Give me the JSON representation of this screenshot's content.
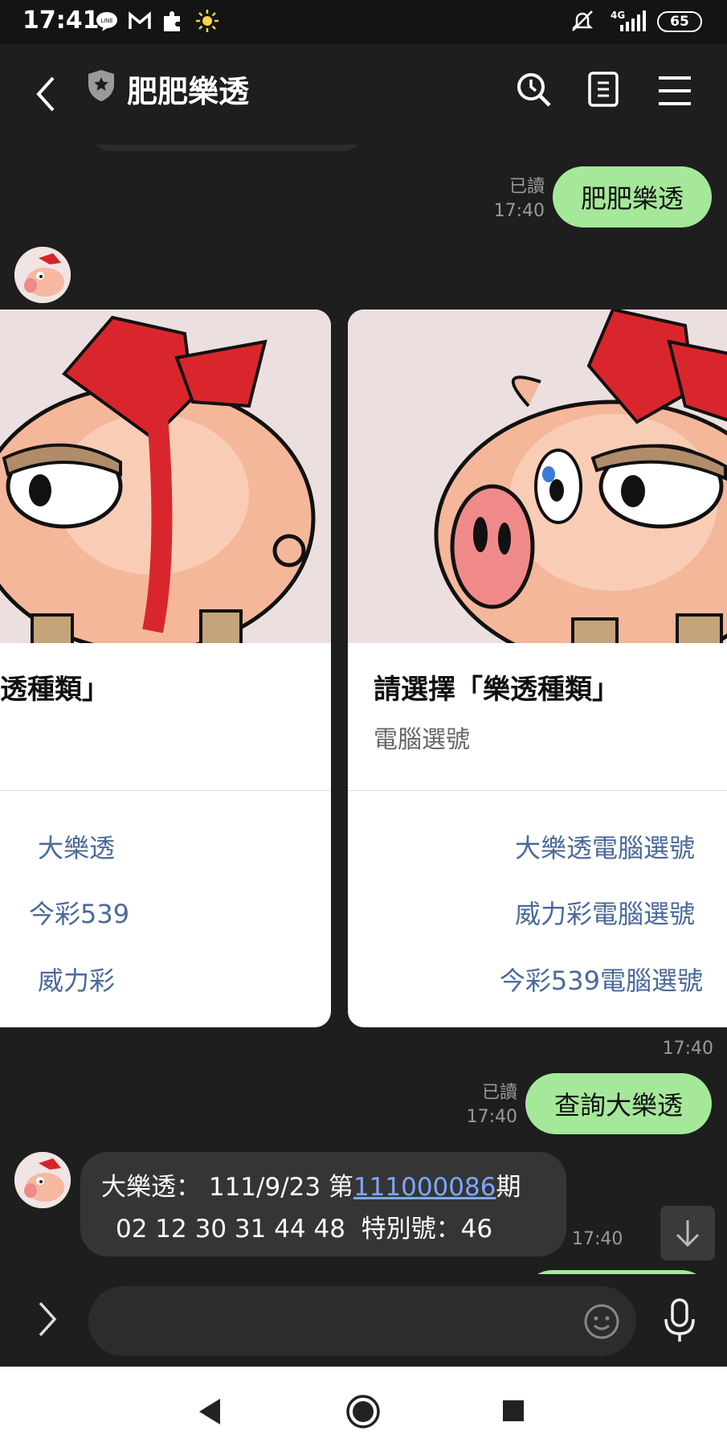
{
  "status_bar": {
    "time": "17:41",
    "network": "4G",
    "battery": "65",
    "icons": [
      "line-icon",
      "gmail-icon",
      "puzzle-icon",
      "sun-icon",
      "mute-icon",
      "signal-icon",
      "battery-icon"
    ]
  },
  "header": {
    "title": "肥肥樂透"
  },
  "messages": {
    "out1": {
      "text": "肥肥樂透",
      "read": "已讀",
      "time": "17:40"
    },
    "carousel": {
      "card_left": {
        "title": "透種類」",
        "actions": [
          "大樂透",
          "今彩539",
          "威力彩"
        ]
      },
      "card_right": {
        "title": "請選擇「樂透種類」",
        "subtitle": "電腦選號",
        "actions": [
          "大樂透電腦選號",
          "威力彩電腦選號",
          "今彩539電腦選號"
        ]
      },
      "time": "17:40"
    },
    "out2": {
      "text": "查詢大樂透",
      "read": "已讀",
      "time": "17:40"
    },
    "in1": {
      "line1_prefix": "大樂透： 111/9/23 第",
      "line1_link": "111000086",
      "line1_suffix": "期",
      "line2": "02 12 30 31 44 48  特別號：46",
      "time": "17:40"
    }
  },
  "colors": {
    "background": "#1e1e1e",
    "outgoing_bubble": "#a5e89a",
    "incoming_bubble": "#353535",
    "link": "#7ea7ff",
    "card_action": "#4a6a9a"
  }
}
